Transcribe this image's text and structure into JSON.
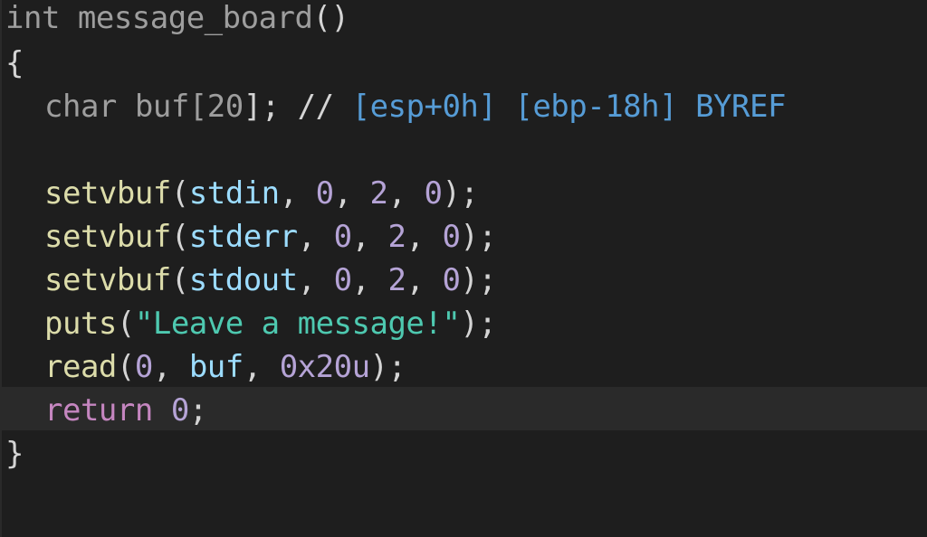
{
  "code": {
    "l1": {
      "kw_int": "int",
      "name": " message_board",
      "parens": "()"
    },
    "l2": {
      "brace": "{"
    },
    "l3": {
      "type": "char",
      "sp": " ",
      "name": "buf",
      "lb": "[",
      "num": "20",
      "rb": "];",
      "sp2": " ",
      "cmt": "//",
      "sp3": " ",
      "r1": "[esp+0h]",
      "sp4": " ",
      "r2": "[ebp-18h]",
      "sp5": " ",
      "r3": "BYREF"
    },
    "l5": {
      "fn": "setvbuf",
      "lp": "(",
      "a1": "stdin",
      "c1": ", ",
      "a2": "0",
      "c2": ", ",
      "a3": "2",
      "c3": ", ",
      "a4": "0",
      "rp": ");"
    },
    "l6": {
      "fn": "setvbuf",
      "lp": "(",
      "a1": "stderr",
      "c1": ", ",
      "a2": "0",
      "c2": ", ",
      "a3": "2",
      "c3": ", ",
      "a4": "0",
      "rp": ");"
    },
    "l7": {
      "fn": "setvbuf",
      "lp": "(",
      "a1": "stdout",
      "c1": ", ",
      "a2": "0",
      "c2": ", ",
      "a3": "2",
      "c3": ", ",
      "a4": "0",
      "rp": ");"
    },
    "l8": {
      "fn": "puts",
      "lp": "(",
      "str": "\"Leave a message!\"",
      "rp": ");"
    },
    "l9": {
      "fn": "read",
      "lp": "(",
      "a1": "0",
      "c1": ", ",
      "a2": "buf",
      "c2": ", ",
      "a3": "0x20u",
      "rp": ");"
    },
    "l10": {
      "kw": "return",
      "sp": " ",
      "num": "0",
      "semi": ";"
    },
    "l11": {
      "brace": "}"
    }
  },
  "colors": {
    "background": "#1e1e1e",
    "current_line": "#2a2a2a",
    "function": "#dcdcaa",
    "number": "#b5a3d6",
    "variable": "#9cdcfe",
    "string": "#4ec9b0",
    "comment_ref": "#569cd6",
    "keyword": "#c586c0"
  }
}
